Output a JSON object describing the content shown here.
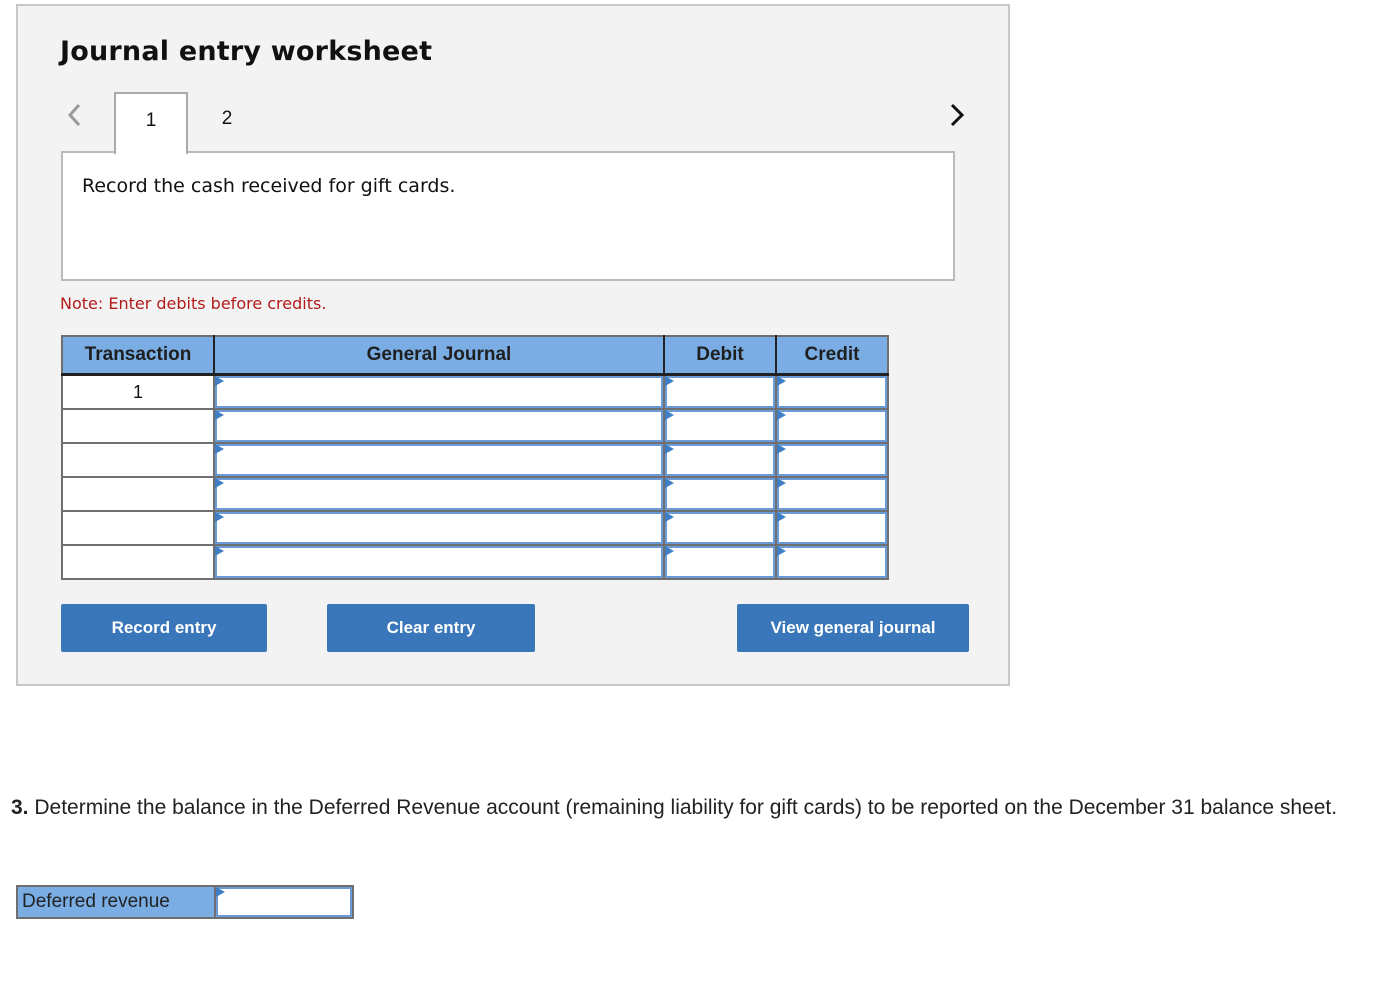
{
  "worksheet": {
    "title": "Journal entry worksheet",
    "nav_prev_icon": "chevron-left-icon",
    "nav_next_icon": "chevron-right-icon",
    "tabs": [
      {
        "label": "1",
        "active": true
      },
      {
        "label": "2",
        "active": false
      }
    ],
    "prompt": "Record the cash received for gift cards.",
    "note": "Note: Enter debits before credits.",
    "table": {
      "headers": [
        "Transaction",
        "General Journal",
        "Debit",
        "Credit"
      ],
      "rows": [
        {
          "transaction": "1",
          "general_journal": "",
          "debit": "",
          "credit": ""
        },
        {
          "transaction": "",
          "general_journal": "",
          "debit": "",
          "credit": ""
        },
        {
          "transaction": "",
          "general_journal": "",
          "debit": "",
          "credit": ""
        },
        {
          "transaction": "",
          "general_journal": "",
          "debit": "",
          "credit": ""
        },
        {
          "transaction": "",
          "general_journal": "",
          "debit": "",
          "credit": ""
        },
        {
          "transaction": "",
          "general_journal": "",
          "debit": "",
          "credit": ""
        }
      ]
    },
    "buttons": {
      "record": "Record entry",
      "clear": "Clear entry",
      "view": "View general journal"
    }
  },
  "question": {
    "number": "3.",
    "text": " Determine the balance in the Deferred Revenue account (remaining liability for gift cards) to be reported on the December 31 balance sheet."
  },
  "deferred_revenue": {
    "label": "Deferred revenue",
    "value": ""
  },
  "colors": {
    "header_blue": "#79ade3",
    "button_blue": "#3a77ba",
    "note_red": "#b21a1a",
    "input_border": "#6b9bd7"
  }
}
